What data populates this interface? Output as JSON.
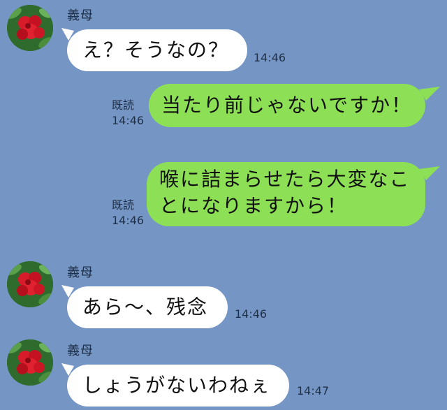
{
  "colors": {
    "background": "#7596c4",
    "incoming_bubble": "#ffffff",
    "outgoing_bubble": "#8de055"
  },
  "messages": [
    {
      "sender": "義母",
      "text": "え？そうなの？",
      "time": "14:46"
    },
    {
      "read": "既読",
      "time": "14:46",
      "text": "当たり前じゃないですか！"
    },
    {
      "read": "既読",
      "time": "14:46",
      "text_line1": "喉に詰まらせたら大変なこ",
      "text_line2": "とになりますから！"
    },
    {
      "sender": "義母",
      "text": "あら～、残念",
      "time": "14:46"
    },
    {
      "sender": "義母",
      "text": "しょうがないわねぇ",
      "time": "14:47"
    }
  ]
}
